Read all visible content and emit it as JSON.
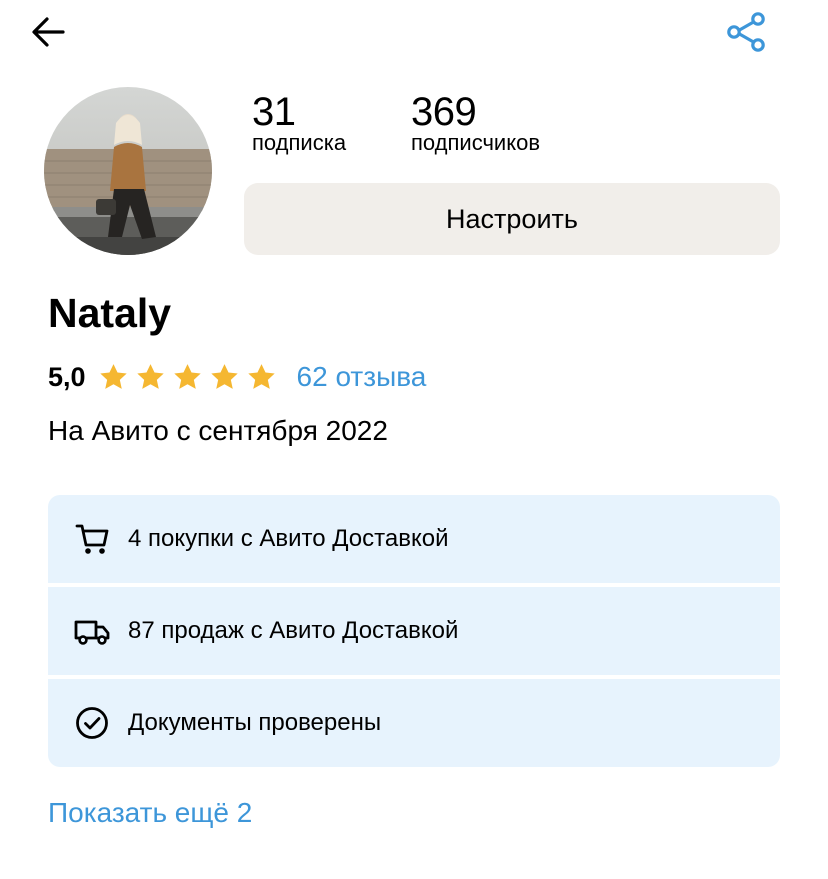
{
  "profile": {
    "name": "Nataly",
    "rating": "5,0",
    "stars_filled": 5,
    "stars_total": 5,
    "reviews_link": "62 отзыва",
    "member_since": "На Авито с сентября 2022"
  },
  "stats": {
    "subscriptions": {
      "value": "31",
      "label": "подписка"
    },
    "followers": {
      "value": "369",
      "label": "подписчиков"
    }
  },
  "actions": {
    "configure_label": "Настроить",
    "show_more_label": "Показать ещё 2"
  },
  "info_items": [
    {
      "icon": "cart-icon",
      "text": "4 покупки с Авито Доставкой"
    },
    {
      "icon": "truck-icon",
      "text": "87 продаж с Авито Доставкой"
    },
    {
      "icon": "check-circle-icon",
      "text": "Документы проверены"
    }
  ],
  "colors": {
    "accent_link": "#3d96d9",
    "star": "#f5b731",
    "info_background": "#e7f3fd",
    "button_background": "#f1eeea"
  }
}
